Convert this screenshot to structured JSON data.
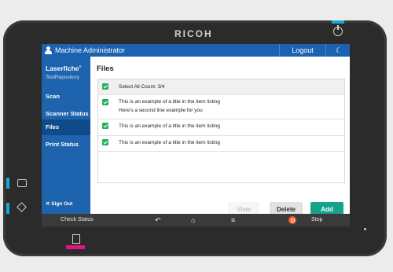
{
  "device": {
    "brand": "RICOH"
  },
  "header": {
    "user": "Machine Administrator",
    "logout_label": "Logout"
  },
  "sidebar": {
    "logo": "Laserfiche",
    "repository": "TestRepository",
    "items": [
      {
        "label": "Scan"
      },
      {
        "label": "Scanner Status"
      },
      {
        "label": "Files",
        "active": true
      },
      {
        "label": "Print Status"
      }
    ],
    "sign_out": "Sign Out"
  },
  "main": {
    "title": "Files",
    "select_all": "Select All Count: 3/4",
    "rows": [
      {
        "line1": "This is an example of a title in the item listing",
        "line2": "Here's a second line example for you"
      },
      {
        "line1": "This is an example of a title in the item listing"
      },
      {
        "line1": "This is an example of a title in the item listing"
      }
    ],
    "buttons": {
      "view": "View",
      "delete": "Delete",
      "add": "Add"
    }
  },
  "bottom_bar": {
    "check_status": "Check Status",
    "stop": "Stop"
  },
  "colors": {
    "accent": "#1b63b0",
    "add_button": "#17a389",
    "checkbox": "#27b05c",
    "stop": "#f0602a"
  }
}
